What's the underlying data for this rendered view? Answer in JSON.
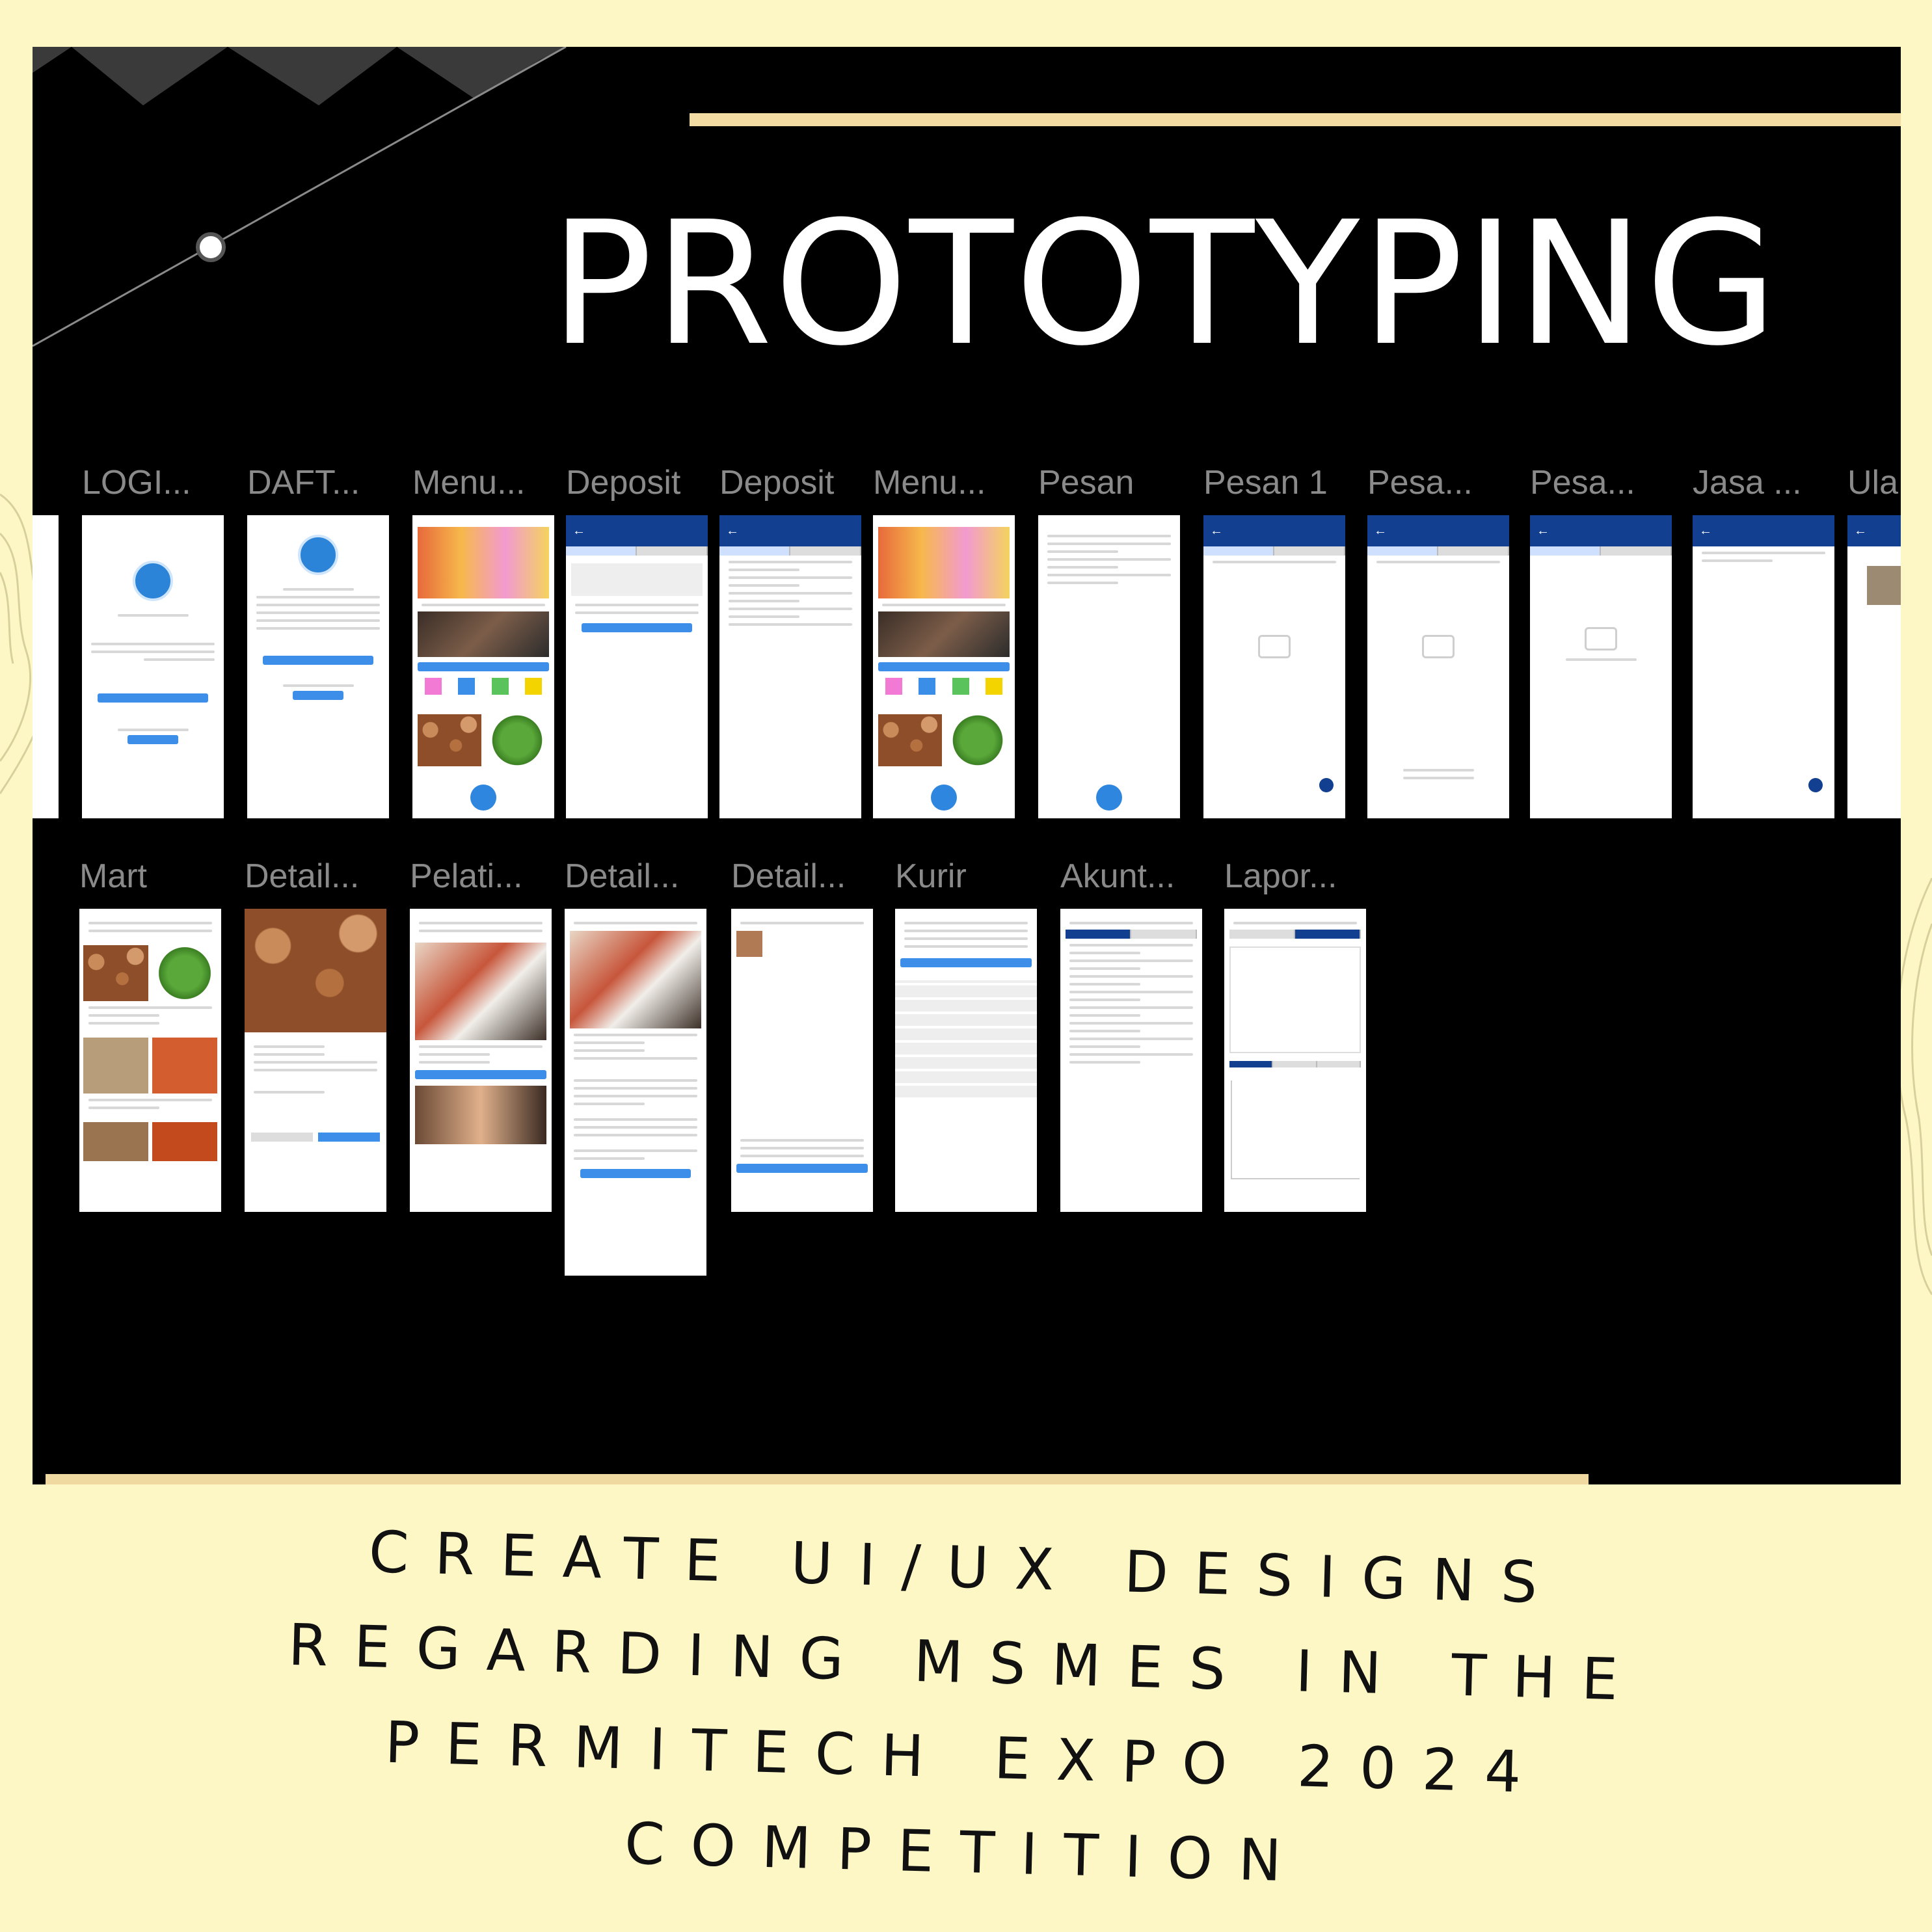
{
  "title": "PROTOTYPING",
  "row1": [
    {
      "label": "LOGI..."
    },
    {
      "label": "DAFT..."
    },
    {
      "label": "Menu..."
    },
    {
      "label": "Deposit"
    },
    {
      "label": "Deposit"
    },
    {
      "label": "Menu..."
    },
    {
      "label": "Pesan"
    },
    {
      "label": "Pesan 1"
    },
    {
      "label": "Pesa..."
    },
    {
      "label": "Pesa..."
    },
    {
      "label": "Jasa ..."
    },
    {
      "label": "Ula"
    }
  ],
  "row2": [
    {
      "label": "Mart"
    },
    {
      "label": "Detail..."
    },
    {
      "label": "Pelati..."
    },
    {
      "label": "Detail..."
    },
    {
      "label": "Detail..."
    },
    {
      "label": "Kurir"
    },
    {
      "label": "Akunt..."
    },
    {
      "label": "Lapor..."
    }
  ],
  "caption": {
    "line1": "CREATE UI/UX DESIGNS",
    "line2": "REGARDING MSMES IN THE",
    "line3": "PERMITECH EXPO 2024",
    "line4": "COMPETITION"
  },
  "colors": {
    "background": "#fdf7c6",
    "canvas": "#000000",
    "gold": "#f3dca4",
    "appbar": "#123f8f",
    "button": "#3d8ee8"
  }
}
